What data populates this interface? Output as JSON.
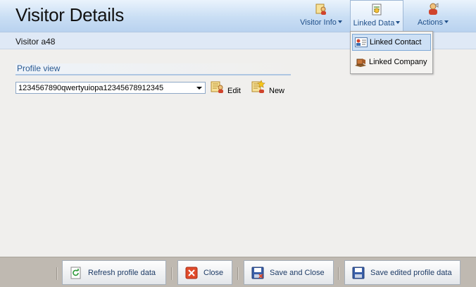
{
  "header": {
    "title": "Visitor Details",
    "buttons": [
      {
        "label": "Visitor Info",
        "icon": "visitor-info-icon"
      },
      {
        "label": "Linked Data",
        "icon": "linked-data-icon"
      },
      {
        "label": "Actions",
        "icon": "actions-icon"
      }
    ]
  },
  "subheader": {
    "visitor_name": "Visitor a48"
  },
  "linked_menu": {
    "items": [
      {
        "label": "Linked Contact",
        "icon": "contact-card-icon"
      },
      {
        "label": "Linked Company",
        "icon": "company-icon"
      }
    ]
  },
  "profile": {
    "section_title": "Profile view",
    "selected_value": "1234567890qwertyuiopa12345678912345",
    "edit_label": "Edit",
    "new_label": "New"
  },
  "footer": {
    "refresh_label": "Refresh profile data",
    "close_label": "Close",
    "save_close_label": "Save and Close",
    "save_edited_label": "Save edited profile data"
  },
  "colors": {
    "header_gradient_top": "#eaf3fc",
    "header_gradient_bottom": "#b9d2ef",
    "link_blue": "#1f4f8a",
    "footer_bg": "#bfb9b1",
    "close_red": "#e04a2a"
  }
}
